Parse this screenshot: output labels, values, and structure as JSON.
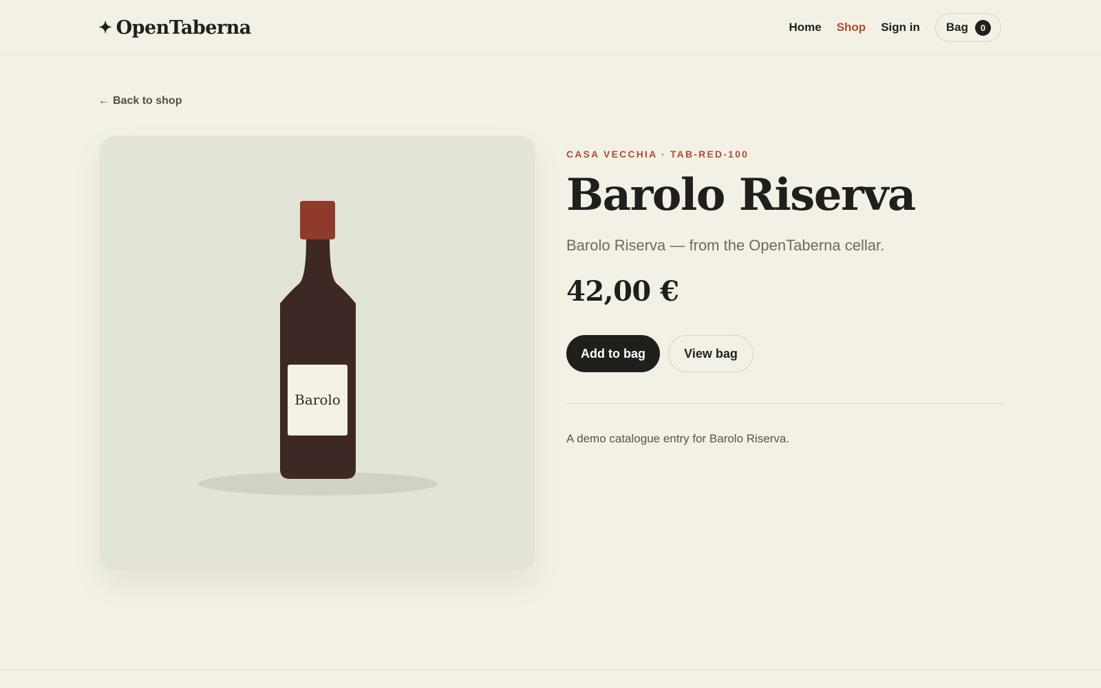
{
  "header": {
    "logo_star": "✦",
    "logo_text": "OpenTaberna",
    "nav": {
      "home": "Home",
      "shop": "Shop",
      "sign_in": "Sign in",
      "bag_label": "Bag",
      "bag_count": "0"
    }
  },
  "back_link": {
    "arrow": "←",
    "label": "Back to shop"
  },
  "product": {
    "eyebrow": "CASA VECCHIA · TAB-RED-100",
    "title": "Barolo Riserva",
    "tagline": "Barolo Riserva — from the OpenTaberna cellar.",
    "price": "42,00 €",
    "bottle_label": "Barolo",
    "description": "A demo catalogue entry for Barolo Riserva."
  },
  "actions": {
    "add_to_bag": "Add to bag",
    "view_bag": "View bag"
  },
  "colors": {
    "background": "#f3f1e6",
    "accent": "#b24a33",
    "ink": "#1f1f1c",
    "card": "#e1e4d6",
    "bottle": "#3d2826",
    "cap": "#8f3a2a"
  },
  "icons": {
    "logo": "sparkle-star-icon",
    "back": "arrow-left-icon"
  }
}
